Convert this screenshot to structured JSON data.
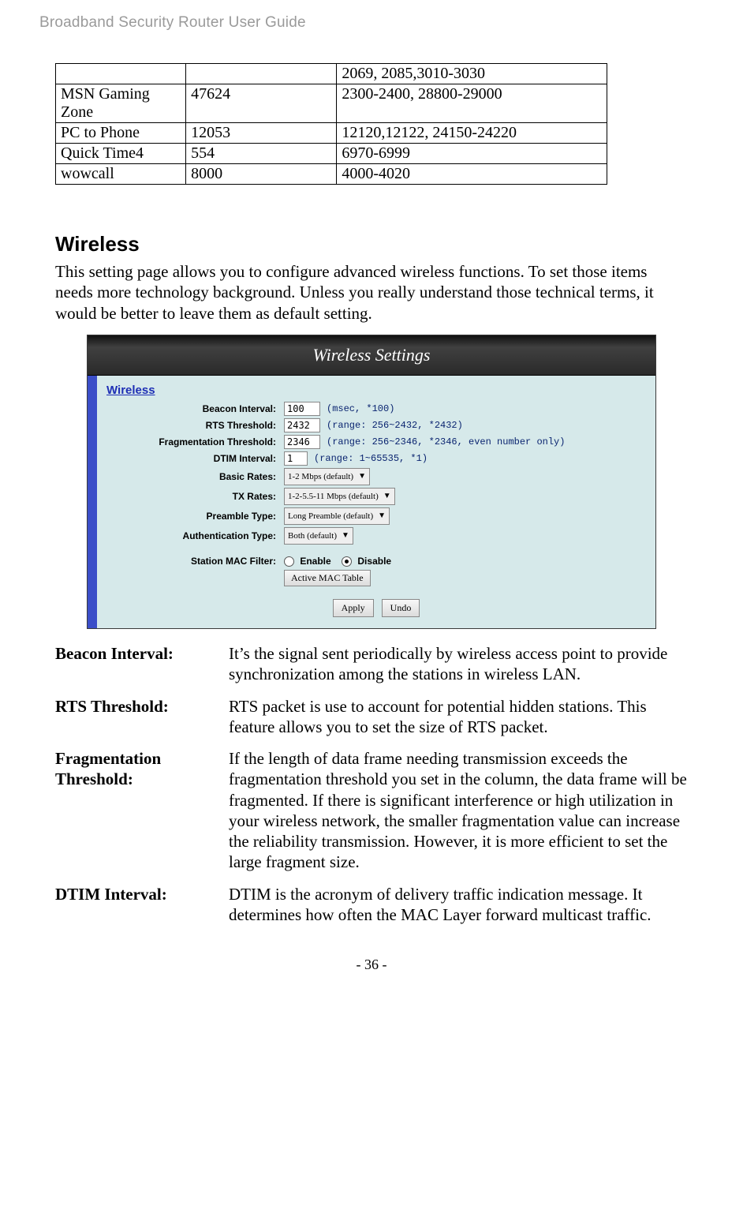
{
  "doc_header": "Broadband Security Router User Guide",
  "port_table": {
    "rows": [
      {
        "app": "",
        "tcp": "",
        "udp": "2069, 2085,3010-3030"
      },
      {
        "app": "MSN Gaming Zone",
        "tcp": "47624",
        "udp": "2300-2400, 28800-29000"
      },
      {
        "app": "PC to Phone",
        "tcp": "12053",
        "udp": "12120,12122, 24150-24220"
      },
      {
        "app": "Quick Time4",
        "tcp": "554",
        "udp": "6970-6999"
      },
      {
        "app": "wowcall",
        "tcp": "8000",
        "udp": "4000-4020"
      }
    ]
  },
  "section": {
    "heading": "Wireless",
    "intro": "This setting page allows you to configure advanced wireless functions. To set those items needs more technology background. Unless you really understand those technical terms, it would be better to leave them as default setting."
  },
  "router_ui": {
    "title": "Wireless Settings",
    "section_head": "Wireless",
    "rows": {
      "beacon": {
        "label": "Beacon Interval:",
        "value": "100",
        "hint": "(msec, *100)"
      },
      "rts": {
        "label": "RTS Threshold:",
        "value": "2432",
        "hint": "(range: 256~2432, *2432)"
      },
      "frag": {
        "label": "Fragmentation Threshold:",
        "value": "2346",
        "hint": "(range: 256~2346, *2346, even number only)"
      },
      "dtim": {
        "label": "DTIM Interval:",
        "value": "1",
        "hint": "(range: 1~65535, *1)"
      },
      "basic": {
        "label": "Basic Rates:",
        "select": "1-2 Mbps (default)"
      },
      "tx": {
        "label": "TX Rates:",
        "select": "1-2-5.5-11 Mbps (default)"
      },
      "preamble": {
        "label": "Preamble Type:",
        "select": "Long Preamble (default)"
      },
      "auth": {
        "label": "Authentication Type:",
        "select": "Both (default)"
      }
    },
    "mac_filter": {
      "label": "Station MAC Filter:",
      "enable_label": "Enable",
      "disable_label": "Disable",
      "active_btn": "Active MAC Table"
    },
    "apply_btn": "Apply",
    "undo_btn": "Undo"
  },
  "definitions": [
    {
      "term": "Beacon Interval:",
      "desc": "It’s the signal sent periodically by wireless access point to provide synchronization among the stations in wireless LAN."
    },
    {
      "term": "RTS Threshold:",
      "desc": "RTS packet is use to account for potential hidden stations. This feature allows you to set the size of RTS packet."
    },
    {
      "term": "Fragmentation Threshold:",
      "desc": "If the length of data frame needing transmission exceeds the fragmentation threshold you set in the column, the data frame will be fragmented. If there is significant interference or high utilization in your wireless network, the smaller fragmentation value can increase the reliability transmission. However, it is more efficient to set the large fragment size."
    },
    {
      "term": "DTIM Interval:",
      "desc": "DTIM is the acronym of delivery traffic indication message. It determines how often the MAC Layer forward multicast traffic."
    }
  ],
  "page_number": "- 36 -"
}
